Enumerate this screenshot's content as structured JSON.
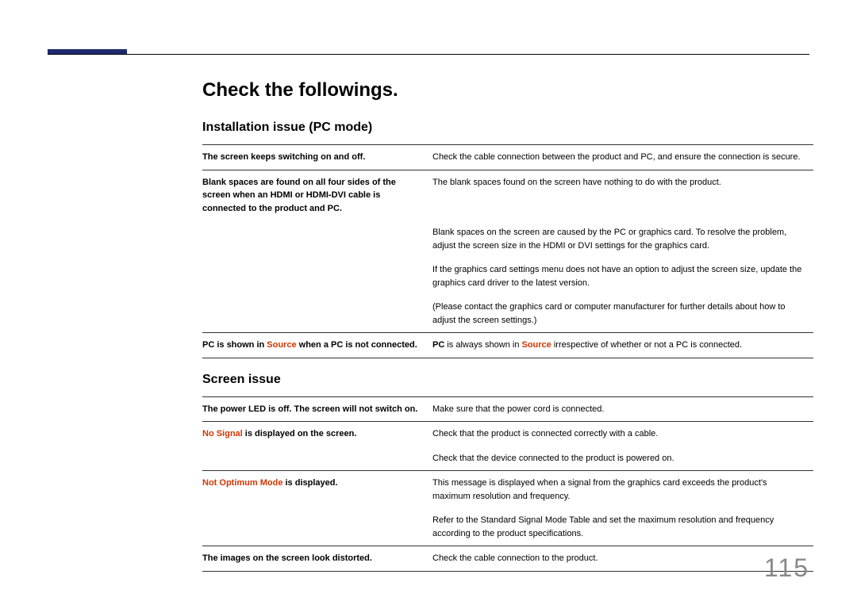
{
  "page_number": "115",
  "heading": "Check the followings.",
  "sections": [
    {
      "title": "Installation issue (PC mode)",
      "rows": [
        {
          "left": {
            "text": "The screen keeps switching on and off."
          },
          "right": [
            {
              "text": "Check the cable connection between the product and PC, and ensure the connection is secure."
            }
          ]
        },
        {
          "left": {
            "text": "Blank spaces are found on all four sides of the screen when an HDMI or HDMI-DVI cable is connected to the product and PC."
          },
          "right": [
            {
              "text": "The blank spaces found on the screen have nothing to do with the product."
            },
            {
              "text": "Blank spaces on the screen are caused by the PC or graphics card. To resolve the problem, adjust the screen size in the HDMI or DVI settings for the graphics card."
            },
            {
              "text": "If the graphics card settings menu does not have an option to adjust the screen size, update the graphics card driver to the latest version."
            },
            {
              "text": "(Please contact the graphics card or computer manufacturer for further details about how to adjust the screen settings.)"
            }
          ]
        },
        {
          "left": {
            "parts": [
              {
                "text": "PC",
                "bold": true
              },
              {
                "text": " is shown in "
              },
              {
                "text": "Source",
                "red": true
              },
              {
                "text": " when a PC is not connected."
              }
            ]
          },
          "right": [
            {
              "parts": [
                {
                  "text": "PC",
                  "bold": true
                },
                {
                  "text": " is always shown in "
                },
                {
                  "text": "Source",
                  "red": true
                },
                {
                  "text": " irrespective of whether or not a PC is connected."
                }
              ]
            }
          ]
        }
      ]
    },
    {
      "title": "Screen issue",
      "rows": [
        {
          "left": {
            "text": "The power LED is off. The screen will not switch on."
          },
          "right": [
            {
              "text": "Make sure that the power cord is connected."
            }
          ]
        },
        {
          "left": {
            "parts": [
              {
                "text": "No Signal",
                "red": true
              },
              {
                "text": " is displayed on the screen."
              }
            ]
          },
          "right": [
            {
              "text": "Check that the product is connected correctly with a cable."
            },
            {
              "text": "Check that the device connected to the product is powered on."
            }
          ]
        },
        {
          "left": {
            "parts": [
              {
                "text": "Not Optimum Mode",
                "red": true
              },
              {
                "text": " is displayed."
              }
            ]
          },
          "right": [
            {
              "text": "This message is displayed when a signal from the graphics card exceeds the product's maximum resolution and frequency."
            },
            {
              "text": "Refer to the Standard Signal Mode Table and set the maximum resolution and frequency according to the product specifications."
            }
          ]
        },
        {
          "left": {
            "text": "The images on the screen look distorted."
          },
          "right": [
            {
              "text": "Check the cable connection to the product."
            }
          ]
        }
      ]
    }
  ]
}
